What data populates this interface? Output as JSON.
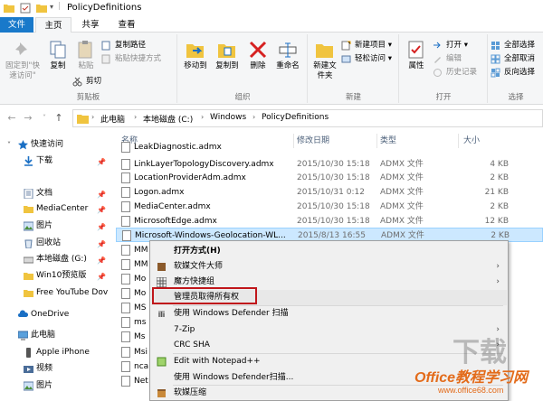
{
  "window": {
    "title": "PolicyDefinitions"
  },
  "tabs": [
    "文件",
    "主页",
    "共享",
    "查看"
  ],
  "ribbon": {
    "clipboard": {
      "label": "剪贴板",
      "pin": "固定到\"快速访问\"",
      "copy": "复制",
      "paste": "粘贴",
      "copy_path": "复制路径",
      "paste_shortcut": "粘贴快捷方式",
      "cut": "剪切"
    },
    "organize": {
      "label": "组织",
      "move_to": "移动到",
      "copy_to": "复制到",
      "delete": "删除",
      "rename": "重命名"
    },
    "new": {
      "label": "新建",
      "new_folder": "新建文件夹",
      "new_item": "新建项目",
      "easy_access": "轻松访问"
    },
    "open": {
      "label": "打开",
      "properties": "属性",
      "open": "打开",
      "edit": "编辑",
      "history": "历史记录"
    },
    "select": {
      "label": "选择",
      "select_all": "全部选择",
      "select_none": "全部取消",
      "invert": "反向选择"
    }
  },
  "address": {
    "crumbs": [
      "此电脑",
      "本地磁盘 (C:)",
      "Windows",
      "PolicyDefinitions"
    ]
  },
  "nav": [
    {
      "label": "快速访问",
      "icon": "star-icon",
      "pinned": false
    },
    {
      "label": "下载",
      "icon": "download-icon",
      "pinned": true
    },
    {
      "label": "文档",
      "icon": "document-icon",
      "pinned": true
    },
    {
      "label": "MediaCenter",
      "icon": "folder-icon",
      "pinned": true
    },
    {
      "label": "图片",
      "icon": "picture-icon",
      "pinned": true
    },
    {
      "label": "回收站",
      "icon": "recycle-bin-icon",
      "pinned": true
    },
    {
      "label": "本地磁盘 (G:)",
      "icon": "drive-icon",
      "pinned": true
    },
    {
      "label": "Win10预览版",
      "icon": "folder-icon",
      "pinned": true
    },
    {
      "label": "Free YouTube Dov",
      "icon": "folder-icon",
      "pinned": false
    },
    {
      "label": "OneDrive",
      "icon": "cloud-icon",
      "pinned": false
    },
    {
      "label": "此电脑",
      "icon": "computer-icon",
      "pinned": false
    },
    {
      "label": "Apple iPhone",
      "icon": "phone-icon",
      "pinned": false
    },
    {
      "label": "视频",
      "icon": "video-icon",
      "pinned": false
    },
    {
      "label": "图片",
      "icon": "picture-icon",
      "pinned": false
    }
  ],
  "columns": {
    "name": "名称",
    "date": "修改日期",
    "type": "类型",
    "size": "大小"
  },
  "files": [
    {
      "name": "LeakDiagnostic.admx",
      "date": "",
      "type": "",
      "size": ""
    },
    {
      "name": "LinkLayerTopologyDiscovery.admx",
      "date": "2015/10/30 15:18",
      "type": "ADMX 文件",
      "size": "4 KB"
    },
    {
      "name": "LocationProviderAdm.admx",
      "date": "2015/10/30 15:18",
      "type": "ADMX 文件",
      "size": "2 KB"
    },
    {
      "name": "Logon.admx",
      "date": "2015/10/31 0:12",
      "type": "ADMX 文件",
      "size": "21 KB"
    },
    {
      "name": "MediaCenter.admx",
      "date": "2015/10/30 15:18",
      "type": "ADMX 文件",
      "size": "2 KB"
    },
    {
      "name": "MicrosoftEdge.admx",
      "date": "2015/10/30 15:18",
      "type": "ADMX 文件",
      "size": "12 KB"
    },
    {
      "name": "Microsoft-Windows-Geolocation-WL...",
      "date": "2015/8/13 16:55",
      "type": "ADMX 文件",
      "size": "2 KB"
    },
    {
      "name": "MM",
      "date": "",
      "type": "",
      "size": ""
    },
    {
      "name": "MM",
      "date": "",
      "type": "",
      "size": ""
    },
    {
      "name": "Mo",
      "date": "",
      "type": "",
      "size": ""
    },
    {
      "name": "Mo",
      "date": "",
      "type": "",
      "size": ""
    },
    {
      "name": "MS",
      "date": "",
      "type": "",
      "size": ""
    },
    {
      "name": "ms",
      "date": "",
      "type": "",
      "size": ""
    },
    {
      "name": "Ms",
      "date": "",
      "type": "",
      "size": ""
    },
    {
      "name": "Msi",
      "date": "",
      "type": "",
      "size": ""
    },
    {
      "name": "nca",
      "date": "",
      "type": "",
      "size": ""
    },
    {
      "name": "Net",
      "date": "",
      "type": "",
      "size": ""
    }
  ],
  "context_menu": {
    "items": [
      {
        "label": "打开方式(H)",
        "bold": true,
        "icon": "",
        "submenu": false
      },
      {
        "label": "软媒文件大师",
        "bold": false,
        "icon": "file-master-icon",
        "submenu": true
      },
      {
        "label": "魔方快捷组",
        "bold": false,
        "icon": "grid-icon",
        "submenu": true
      },
      {
        "label": "管理员取得所有权",
        "bold": false,
        "icon": "",
        "submenu": false,
        "highlighted": true
      },
      {
        "label": "使用 Windows Defender 扫描",
        "bold": false,
        "icon": "defender-icon",
        "submenu": false
      },
      {
        "label": "7-Zip",
        "bold": false,
        "icon": "",
        "submenu": true
      },
      {
        "label": "CRC SHA",
        "bold": false,
        "icon": "",
        "submenu": true
      },
      {
        "label": "Edit with Notepad++",
        "bold": false,
        "icon": "notepad-icon",
        "submenu": false
      },
      {
        "label": "使用 Windows Defender扫描...",
        "bold": false,
        "icon": "",
        "submenu": false
      },
      {
        "label": "软媒压缩",
        "bold": false,
        "icon": "archive-icon",
        "submenu": false
      }
    ]
  },
  "watermark": {
    "text": "Office教程学习网",
    "url": "www.office68.com",
    "faint": "下载"
  },
  "colors": {
    "accent": "#1979ca",
    "selection": "#cce8ff",
    "highlight_box": "#c0161b"
  }
}
